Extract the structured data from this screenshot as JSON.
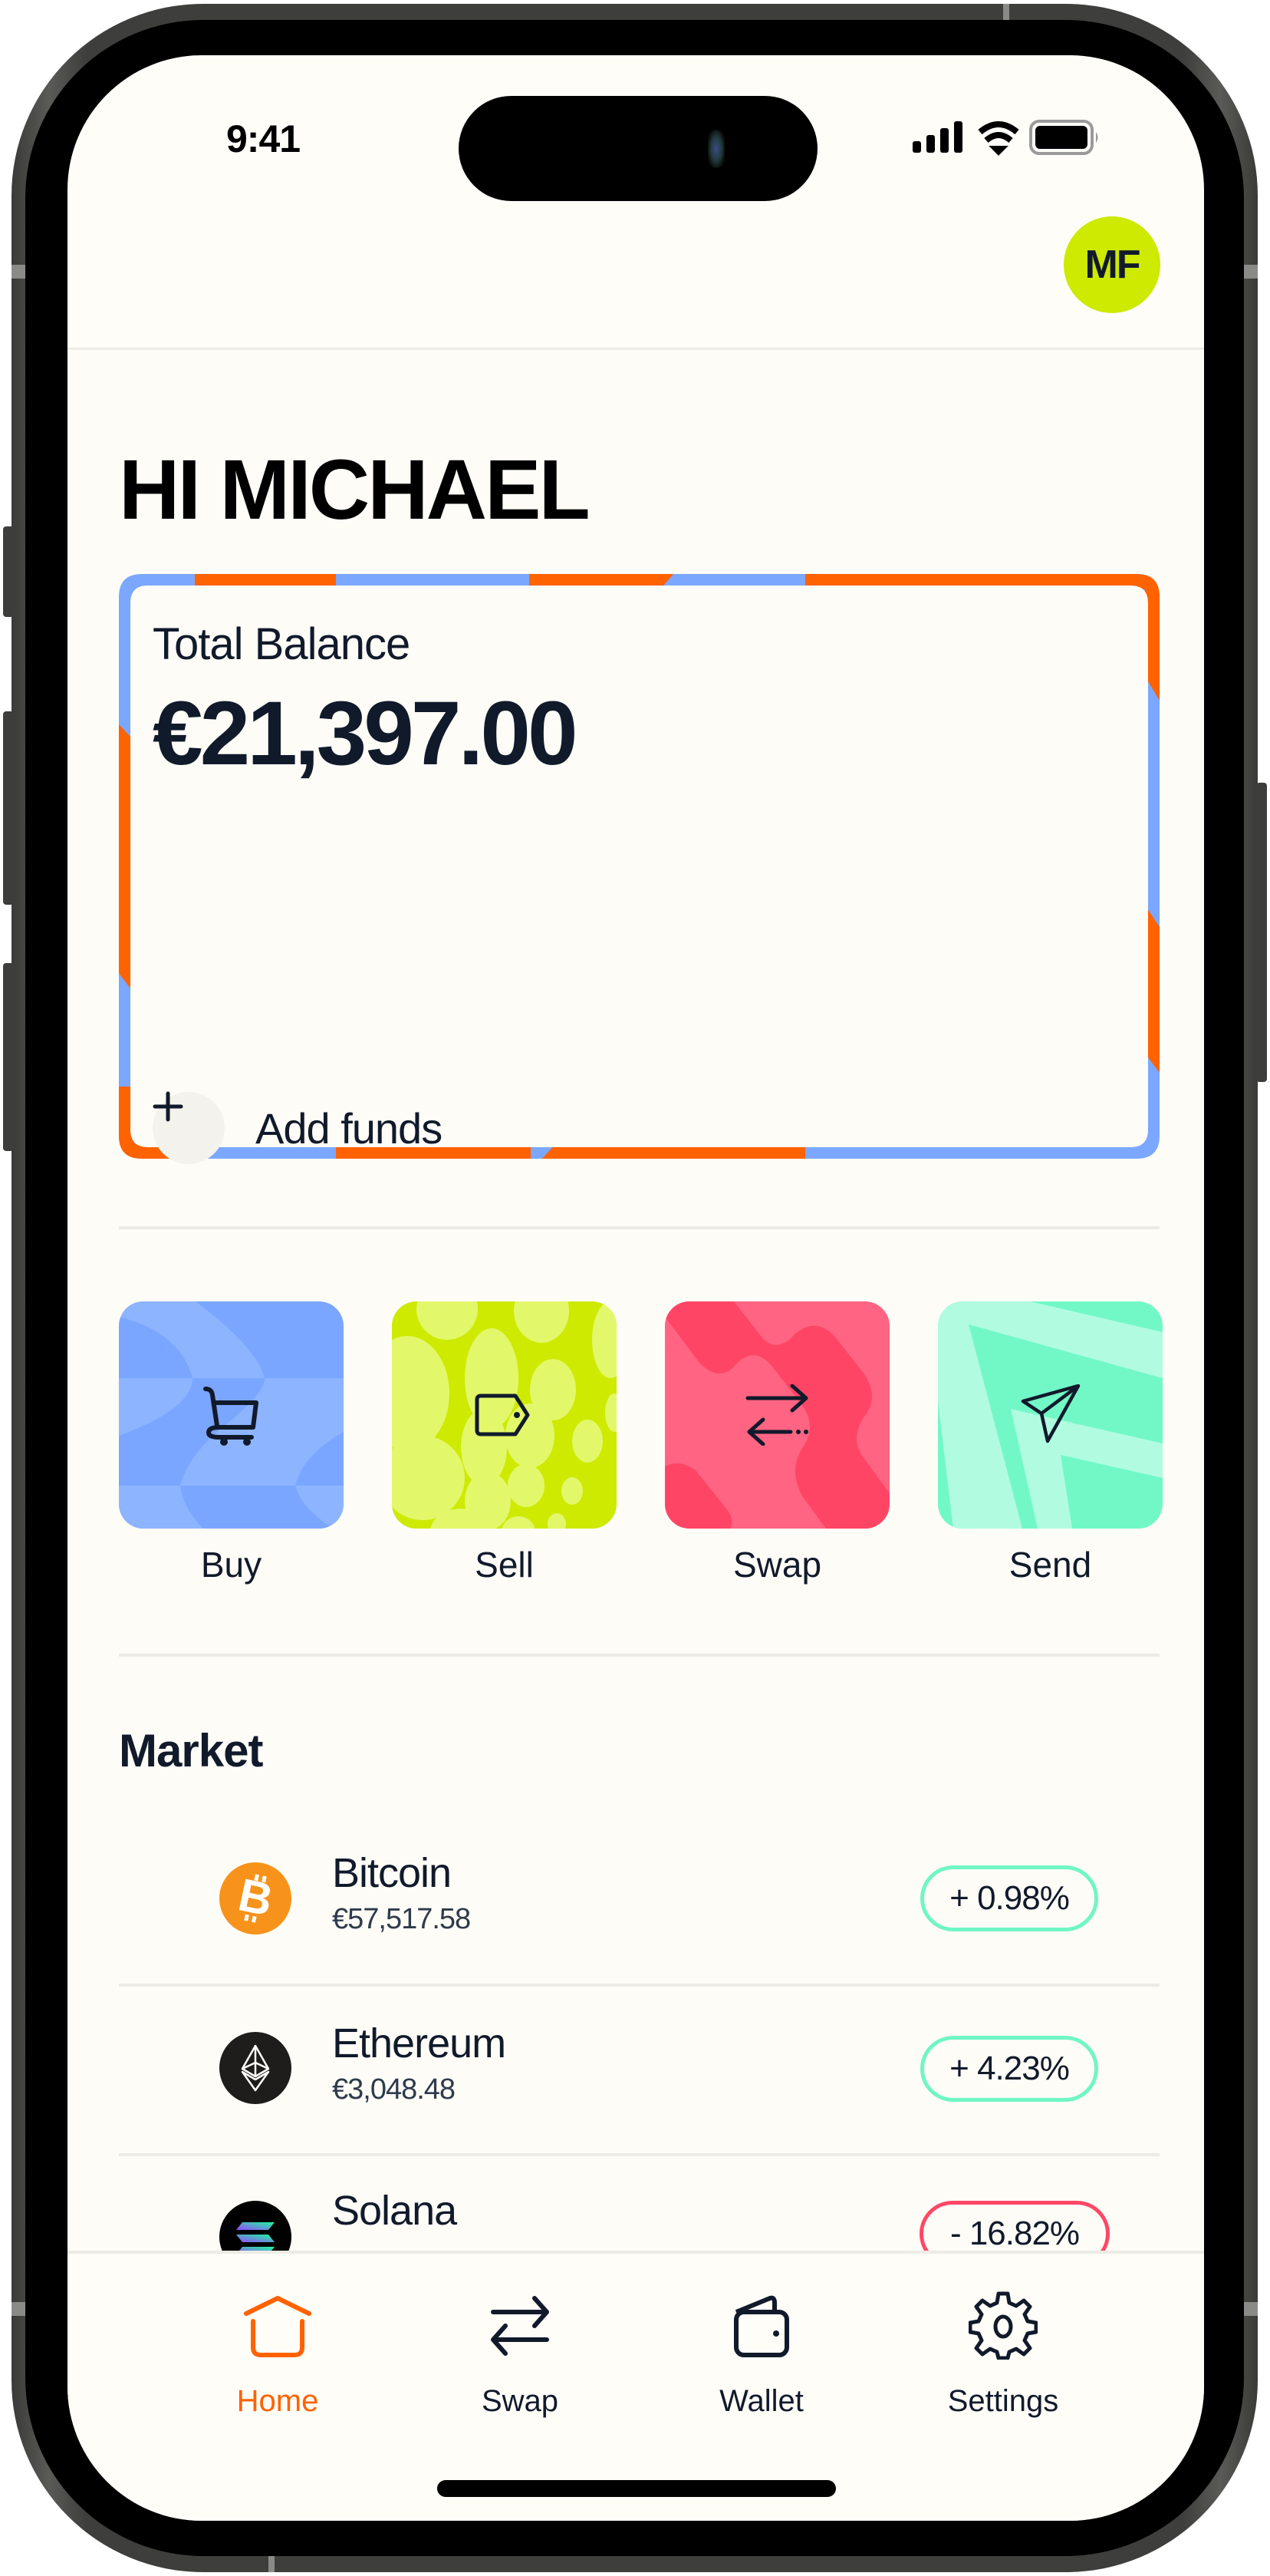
{
  "status_bar": {
    "time": "9:41",
    "signal_icon": "cellular-signal-icon",
    "wifi_icon": "wifi-icon",
    "battery_icon": "battery-icon"
  },
  "header": {
    "avatar_initials": "MF"
  },
  "greeting": "HI MICHAEL",
  "balance_card": {
    "label": "Total Balance",
    "amount": "€21,397.00",
    "add_funds_label": "Add funds",
    "add_icon": "plus-icon",
    "border_colors": {
      "orange": "#ff6200",
      "blue": "#7ba7ff"
    }
  },
  "actions": [
    {
      "label": "Buy",
      "icon": "shopping-cart-icon",
      "color": "#7ba7ff"
    },
    {
      "label": "Sell",
      "icon": "price-tag-icon",
      "color": "#cdea00"
    },
    {
      "label": "Swap",
      "icon": "swap-arrows-icon",
      "color": "#ff4766"
    },
    {
      "label": "Send",
      "icon": "paper-plane-icon",
      "color": "#72f8c7"
    }
  ],
  "market": {
    "title": "Market",
    "items": [
      {
        "name": "Bitcoin",
        "price": "€57,517.58",
        "change": "+ 0.98%",
        "direction": "up",
        "icon": "bitcoin-icon"
      },
      {
        "name": "Ethereum",
        "price": "€3,048.48",
        "change": "+ 4.23%",
        "direction": "up",
        "icon": "ethereum-icon"
      },
      {
        "name": "Solana",
        "price": "",
        "change": "- 16.82%",
        "direction": "down",
        "icon": "solana-icon"
      }
    ]
  },
  "tabbar": {
    "active": "Home",
    "accent": "#ff6200",
    "tabs": [
      {
        "label": "Home",
        "icon": "home-icon"
      },
      {
        "label": "Swap",
        "icon": "swap-icon"
      },
      {
        "label": "Wallet",
        "icon": "wallet-icon"
      },
      {
        "label": "Settings",
        "icon": "gear-icon"
      }
    ]
  }
}
